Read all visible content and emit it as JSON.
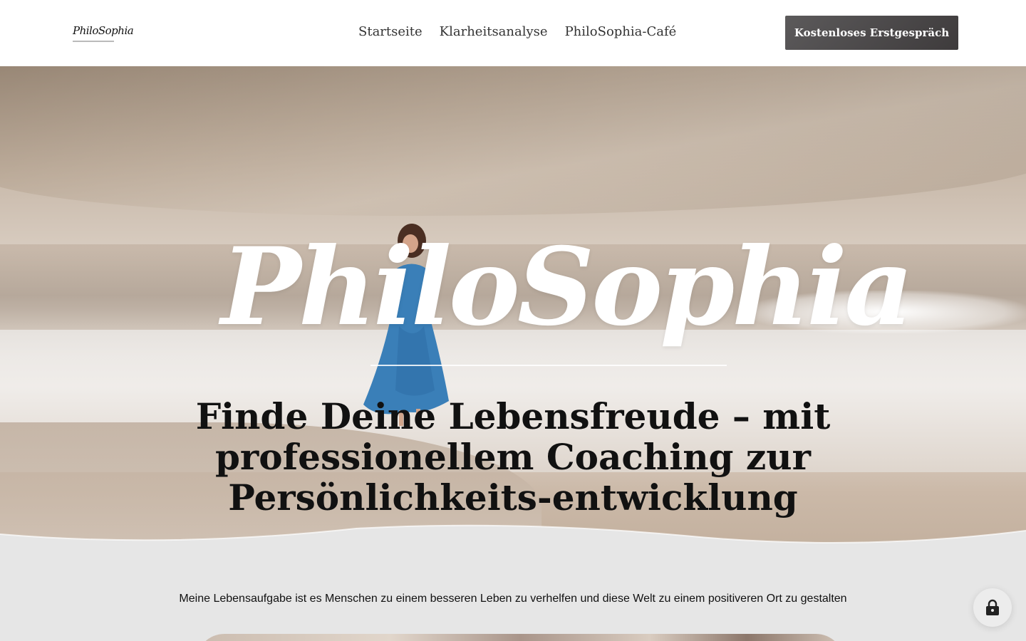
{
  "header": {
    "logo_text": "PhiloSophia",
    "nav": [
      {
        "label": "Startseite"
      },
      {
        "label": "Klarheitsanalyse"
      },
      {
        "label": "PhiloSophia-Café"
      }
    ],
    "cta_label": "Kostenloses Erstgespräch"
  },
  "hero": {
    "script_title": "PhiloSophia",
    "headline": "Finde Deine Lebensfreude – mit professionellem Coaching zur Persönlichkeits-entwicklung"
  },
  "content": {
    "tagline": "Meine Lebensaufgabe ist es Menschen zu einem besseren Leben zu verhelfen und diese Welt zu einem positiveren Ort zu gestalten"
  },
  "colors": {
    "cta_bg": "#4a4748",
    "page_bg": "#e6e6e6",
    "dress_blue": "#3a7fb8"
  },
  "icons": {
    "lock": "lock-icon"
  }
}
